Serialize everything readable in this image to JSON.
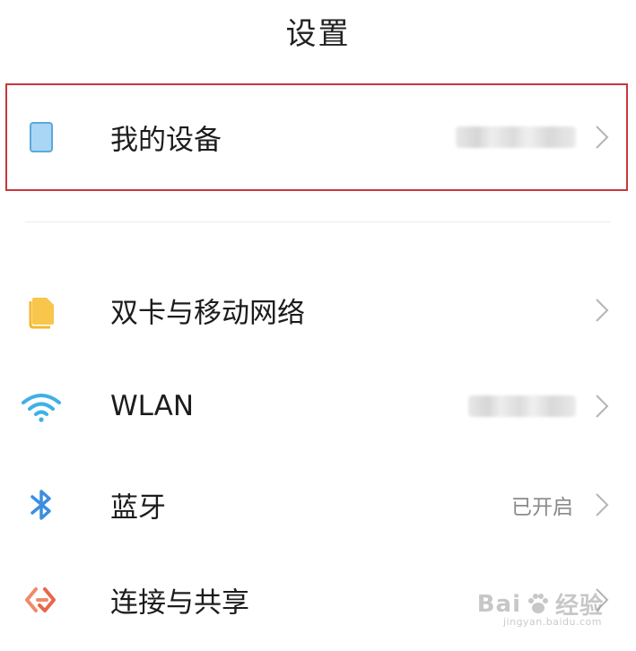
{
  "header": {
    "title": "设置"
  },
  "items": [
    {
      "label": "我的设备",
      "value": "",
      "value_hidden": true,
      "icon": "device-icon"
    },
    {
      "label": "双卡与移动网络",
      "value": "",
      "icon": "sim-card-icon"
    },
    {
      "label": "WLAN",
      "value": "",
      "value_hidden": true,
      "icon": "wifi-icon"
    },
    {
      "label": "蓝牙",
      "value": "已开启",
      "icon": "bluetooth-icon"
    },
    {
      "label": "连接与共享",
      "value": "",
      "icon": "connection-sharing-icon"
    }
  ],
  "watermark": {
    "brand": "Bai",
    "brand2": "经验",
    "url": "jingyan.baidu.com"
  },
  "colors": {
    "highlight_border": "#c9373b",
    "device_icon": "#a9d6f5",
    "sim_icon": "#f7c64a",
    "wifi_icon": "#3fb0e6",
    "bluetooth_icon": "#3c8ee0",
    "share_icon": "#f08a6a",
    "chevron": "#b5b5b5"
  }
}
